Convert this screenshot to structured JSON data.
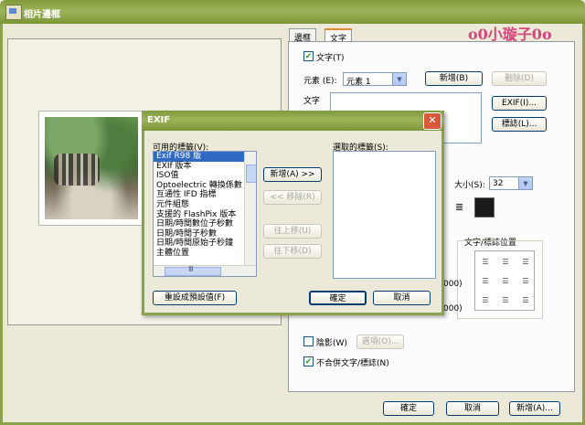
{
  "window": {
    "title": "相片邊框"
  },
  "logo": "o0小璇子0o",
  "tabs": [
    {
      "label": "邊框"
    },
    {
      "label": "文字"
    }
  ],
  "text_tab": {
    "text_checkbox": "文字(T)",
    "element_label": "元素 (E):",
    "element_value": "元素 1",
    "new_button": "新增(B)",
    "delete_button": "刪除(D)",
    "text_label": "文字",
    "exif_button": "EXIF(I)...",
    "tag_button": "標誌(L)...",
    "size_label": "大小(S):",
    "size_value": "32",
    "position_label": "文字/標誌位置",
    "value_a": "000)",
    "value_b": "000)",
    "shadow_checkbox": "陰影(W)",
    "options_button": "選項(O)...",
    "no_merge_checkbox": "不合併文字/標誌(N)"
  },
  "bottom": {
    "ok": "確定",
    "cancel": "取消",
    "new": "新增(A)..."
  },
  "exif": {
    "title": "EXIF",
    "available_label": "可用的標籤(V):",
    "selected_label": "選取的標籤(S):",
    "available_items": [
      "Exif R98 版",
      "EXIf 版本",
      "ISO值",
      "Optoelectric 轉換係數",
      "互通性 IFD 指標",
      "元件組態",
      "支援的 FlashPix 版本",
      "日期/時間數位子秒數",
      "日期/時間子秒數",
      "日期/時間原始子秒鐘",
      "主體位置"
    ],
    "add_button": "新增(A) >>",
    "remove_button": "<< 移除(R)",
    "up_button": "往上移(U)",
    "down_button": "往下移(D)",
    "reset_button": "重設成預設值(F)",
    "ok_button": "確定",
    "cancel_button": "取消",
    "hscroll_mark": "Ⅲ"
  }
}
